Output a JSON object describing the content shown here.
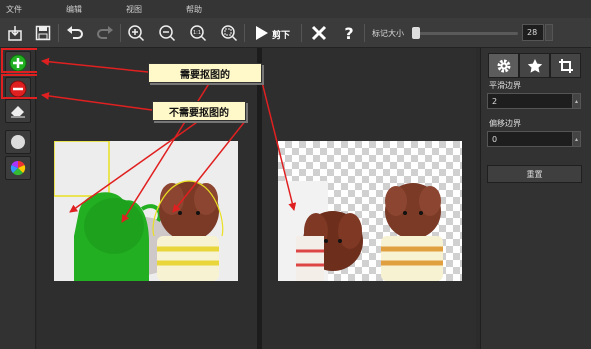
{
  "menu": [
    "文件",
    "编辑",
    "视图",
    "帮助"
  ],
  "toolbar": {
    "cut_label": "剪下",
    "marker_size_label": "标记大小",
    "marker_size_value": "28"
  },
  "right_panel": {
    "smooth_edge_label": "平滑边界",
    "smooth_edge_value": "2",
    "offset_edge_label": "偏移边界",
    "offset_edge_value": "0",
    "reset_label": "重置"
  },
  "annotations": {
    "keep_callout": "需要抠图的",
    "remove_callout": "不需要抠图的"
  },
  "colors": {
    "keep_marker": "#22b022",
    "remove_marker": "#e02020",
    "annotation_red": "#e02020"
  },
  "icons": [
    "import-icon",
    "save-icon",
    "undo-icon",
    "redo-icon",
    "zoom-in-icon",
    "zoom-out-icon",
    "actual-size-icon",
    "fit-window-icon",
    "play-icon",
    "close-icon",
    "help-icon",
    "add-marker-icon",
    "remove-marker-icon",
    "eraser-icon",
    "circle-icon",
    "color-wheel-icon",
    "gear-icon",
    "star-icon",
    "crop-icon"
  ]
}
